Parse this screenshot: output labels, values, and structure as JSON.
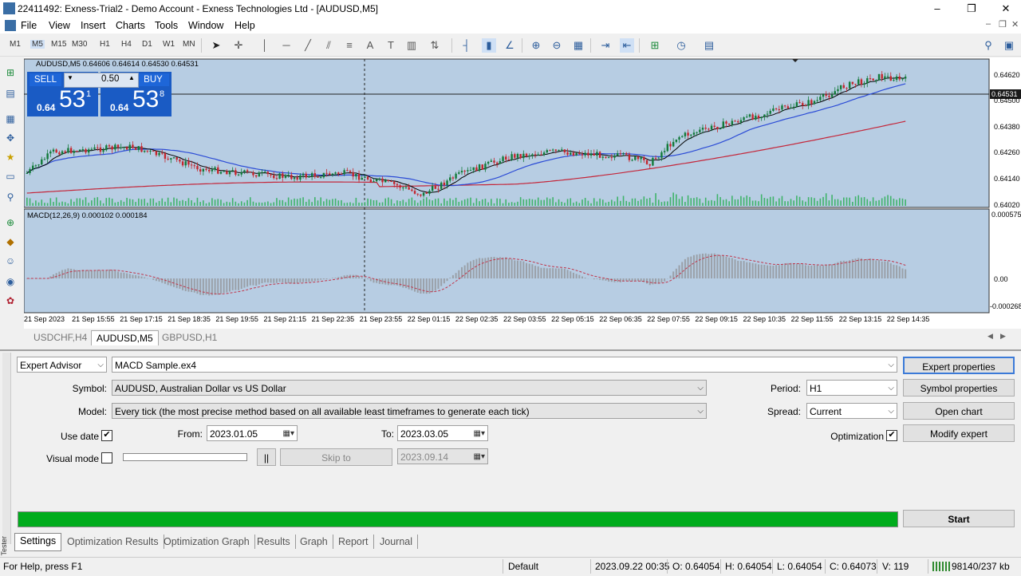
{
  "window": {
    "title": "22411492: Exness-Trial2 - Demo Account - Exness Technologies Ltd - [AUDUSD,M5]",
    "controls": [
      "–",
      "❐",
      "✕"
    ]
  },
  "menu": [
    "File",
    "View",
    "Insert",
    "Charts",
    "Tools",
    "Window",
    "Help"
  ],
  "timeframes": [
    "M1",
    "M5",
    "M15",
    "M30",
    "H1",
    "H4",
    "D1",
    "W1",
    "MN"
  ],
  "chart": {
    "header": "AUDUSD,M5  0.64606 0.64614 0.64530 0.64531",
    "trade": {
      "sell_label": "SELL",
      "buy_label": "BUY",
      "lot": "0.50",
      "sell_small": "0.64",
      "sell_big": "53",
      "sell_sup": "1",
      "buy_small": "0.64",
      "buy_big": "53",
      "buy_sup": "8"
    },
    "price_labels": [
      "0.64620",
      "0.64500",
      "0.64380",
      "0.64260",
      "0.64140",
      "0.64020"
    ],
    "current_price": "0.64531",
    "macd_header": "MACD(12,26,9) 0.000102 0.000184",
    "macd_labels": [
      "0.000575",
      "0.00",
      "-0.000268"
    ],
    "time_labels": [
      "21 Sep 2023",
      "21 Sep 15:55",
      "21 Sep 17:15",
      "21 Sep 18:35",
      "21 Sep 19:55",
      "21 Sep 21:15",
      "21 Sep 22:35",
      "21 Sep 23:55",
      "22 Sep 01:15",
      "22 Sep 02:35",
      "22 Sep 03:55",
      "22 Sep 05:15",
      "22 Sep 06:35",
      "22 Sep 07:55",
      "22 Sep 09:15",
      "22 Sep 10:35",
      "22 Sep 11:55",
      "22 Sep 13:15",
      "22 Sep 14:35"
    ],
    "colors": {
      "bg": "#b7cde3",
      "bull": "#127a3a",
      "bear": "#c4262e",
      "ma_fast": "#000000",
      "ma_mid": "#2b4bd6",
      "ma_slow": "#c4263a",
      "volume": "#3fb36a",
      "macd_hist": "#9aa0a8",
      "macd_signal": "#c0354a"
    }
  },
  "chart_tabs": [
    "USDCHF,H4",
    "AUDUSD,M5",
    "GBPUSD,H1"
  ],
  "tester": {
    "ea_type": "Expert Advisor",
    "ea_file": "MACD Sample.ex4",
    "symbol_label": "Symbol:",
    "symbol": "AUDUSD, Australian Dollar vs US Dollar",
    "model_label": "Model:",
    "model": "Every tick (the most precise method based on all available least timeframes to generate each tick)",
    "use_date_label": "Use date",
    "from_label": "From:",
    "from_date": "2023.01.05",
    "to_label": "To:",
    "to_date": "2023.03.05",
    "visual_mode_label": "Visual mode",
    "pause_label": "||",
    "skip_to_label": "Skip to",
    "skip_date": "2023.09.14",
    "period_label": "Period:",
    "period": "H1",
    "spread_label": "Spread:",
    "spread": "Current",
    "optimization_label": "Optimization",
    "buttons": {
      "expert_properties": "Expert properties",
      "symbol_properties": "Symbol properties",
      "open_chart": "Open chart",
      "modify_expert": "Modify expert",
      "start": "Start"
    },
    "progress": 1.0,
    "side_label": "Tester",
    "tabs": [
      "Settings",
      "Optimization Results",
      "Optimization Graph",
      "Results",
      "Graph",
      "Report",
      "Journal"
    ]
  },
  "status": {
    "help": "For Help, press F1",
    "profile": "Default",
    "datetime": "2023.09.22 00:35",
    "open": "O: 0.64054",
    "high": "H: 0.64054",
    "low": "L: 0.64054",
    "close": "C: 0.64073",
    "volume": "V: 119",
    "traffic": "98140/237 kb"
  }
}
